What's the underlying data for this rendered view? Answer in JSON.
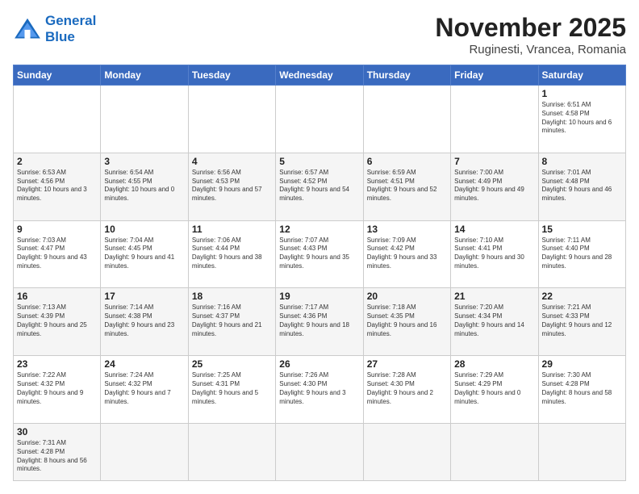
{
  "logo": {
    "line1": "General",
    "line2": "Blue"
  },
  "title": "November 2025",
  "location": "Ruginesti, Vrancea, Romania",
  "headers": [
    "Sunday",
    "Monday",
    "Tuesday",
    "Wednesday",
    "Thursday",
    "Friday",
    "Saturday"
  ],
  "weeks": [
    [
      {
        "day": "",
        "info": ""
      },
      {
        "day": "",
        "info": ""
      },
      {
        "day": "",
        "info": ""
      },
      {
        "day": "",
        "info": ""
      },
      {
        "day": "",
        "info": ""
      },
      {
        "day": "",
        "info": ""
      },
      {
        "day": "1",
        "info": "Sunrise: 6:51 AM\nSunset: 4:58 PM\nDaylight: 10 hours and 6 minutes."
      }
    ],
    [
      {
        "day": "2",
        "info": "Sunrise: 6:53 AM\nSunset: 4:56 PM\nDaylight: 10 hours and 3 minutes."
      },
      {
        "day": "3",
        "info": "Sunrise: 6:54 AM\nSunset: 4:55 PM\nDaylight: 10 hours and 0 minutes."
      },
      {
        "day": "4",
        "info": "Sunrise: 6:56 AM\nSunset: 4:53 PM\nDaylight: 9 hours and 57 minutes."
      },
      {
        "day": "5",
        "info": "Sunrise: 6:57 AM\nSunset: 4:52 PM\nDaylight: 9 hours and 54 minutes."
      },
      {
        "day": "6",
        "info": "Sunrise: 6:59 AM\nSunset: 4:51 PM\nDaylight: 9 hours and 52 minutes."
      },
      {
        "day": "7",
        "info": "Sunrise: 7:00 AM\nSunset: 4:49 PM\nDaylight: 9 hours and 49 minutes."
      },
      {
        "day": "8",
        "info": "Sunrise: 7:01 AM\nSunset: 4:48 PM\nDaylight: 9 hours and 46 minutes."
      }
    ],
    [
      {
        "day": "9",
        "info": "Sunrise: 7:03 AM\nSunset: 4:47 PM\nDaylight: 9 hours and 43 minutes."
      },
      {
        "day": "10",
        "info": "Sunrise: 7:04 AM\nSunset: 4:45 PM\nDaylight: 9 hours and 41 minutes."
      },
      {
        "day": "11",
        "info": "Sunrise: 7:06 AM\nSunset: 4:44 PM\nDaylight: 9 hours and 38 minutes."
      },
      {
        "day": "12",
        "info": "Sunrise: 7:07 AM\nSunset: 4:43 PM\nDaylight: 9 hours and 35 minutes."
      },
      {
        "day": "13",
        "info": "Sunrise: 7:09 AM\nSunset: 4:42 PM\nDaylight: 9 hours and 33 minutes."
      },
      {
        "day": "14",
        "info": "Sunrise: 7:10 AM\nSunset: 4:41 PM\nDaylight: 9 hours and 30 minutes."
      },
      {
        "day": "15",
        "info": "Sunrise: 7:11 AM\nSunset: 4:40 PM\nDaylight: 9 hours and 28 minutes."
      }
    ],
    [
      {
        "day": "16",
        "info": "Sunrise: 7:13 AM\nSunset: 4:39 PM\nDaylight: 9 hours and 25 minutes."
      },
      {
        "day": "17",
        "info": "Sunrise: 7:14 AM\nSunset: 4:38 PM\nDaylight: 9 hours and 23 minutes."
      },
      {
        "day": "18",
        "info": "Sunrise: 7:16 AM\nSunset: 4:37 PM\nDaylight: 9 hours and 21 minutes."
      },
      {
        "day": "19",
        "info": "Sunrise: 7:17 AM\nSunset: 4:36 PM\nDaylight: 9 hours and 18 minutes."
      },
      {
        "day": "20",
        "info": "Sunrise: 7:18 AM\nSunset: 4:35 PM\nDaylight: 9 hours and 16 minutes."
      },
      {
        "day": "21",
        "info": "Sunrise: 7:20 AM\nSunset: 4:34 PM\nDaylight: 9 hours and 14 minutes."
      },
      {
        "day": "22",
        "info": "Sunrise: 7:21 AM\nSunset: 4:33 PM\nDaylight: 9 hours and 12 minutes."
      }
    ],
    [
      {
        "day": "23",
        "info": "Sunrise: 7:22 AM\nSunset: 4:32 PM\nDaylight: 9 hours and 9 minutes."
      },
      {
        "day": "24",
        "info": "Sunrise: 7:24 AM\nSunset: 4:32 PM\nDaylight: 9 hours and 7 minutes."
      },
      {
        "day": "25",
        "info": "Sunrise: 7:25 AM\nSunset: 4:31 PM\nDaylight: 9 hours and 5 minutes."
      },
      {
        "day": "26",
        "info": "Sunrise: 7:26 AM\nSunset: 4:30 PM\nDaylight: 9 hours and 3 minutes."
      },
      {
        "day": "27",
        "info": "Sunrise: 7:28 AM\nSunset: 4:30 PM\nDaylight: 9 hours and 2 minutes."
      },
      {
        "day": "28",
        "info": "Sunrise: 7:29 AM\nSunset: 4:29 PM\nDaylight: 9 hours and 0 minutes."
      },
      {
        "day": "29",
        "info": "Sunrise: 7:30 AM\nSunset: 4:28 PM\nDaylight: 8 hours and 58 minutes."
      }
    ],
    [
      {
        "day": "30",
        "info": "Sunrise: 7:31 AM\nSunset: 4:28 PM\nDaylight: 8 hours and 56 minutes."
      },
      {
        "day": "",
        "info": ""
      },
      {
        "day": "",
        "info": ""
      },
      {
        "day": "",
        "info": ""
      },
      {
        "day": "",
        "info": ""
      },
      {
        "day": "",
        "info": ""
      },
      {
        "day": "",
        "info": ""
      }
    ]
  ]
}
